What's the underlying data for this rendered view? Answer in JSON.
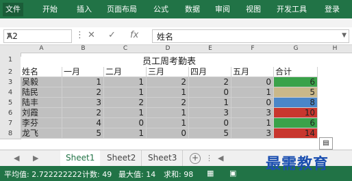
{
  "ribbon": {
    "tabs": [
      "文件",
      "开始",
      "插入",
      "页面布局",
      "公式",
      "数据",
      "审阅",
      "视图",
      "开发工具",
      "登录"
    ]
  },
  "formula_bar": {
    "name_box": "A2",
    "fx": "fx",
    "value": "姓名"
  },
  "columns": [
    "A",
    "B",
    "C",
    "D",
    "E",
    "F",
    "G",
    "H"
  ],
  "rows": [
    "1",
    "2",
    "3",
    "4",
    "5",
    "6",
    "7",
    "8"
  ],
  "table": {
    "title": "员工周考勤表",
    "headers": [
      "姓名",
      "一月",
      "二月",
      "三月",
      "四月",
      "五月",
      "合计"
    ],
    "data": [
      {
        "name": "吴毅",
        "v": [
          1,
          1,
          2,
          2,
          0
        ],
        "total": 6,
        "color": "#3aa24a"
      },
      {
        "name": "陆民",
        "v": [
          2,
          1,
          1,
          0,
          1
        ],
        "total": 5,
        "color": "#c9b88a"
      },
      {
        "name": "陆丰",
        "v": [
          3,
          2,
          2,
          1,
          0
        ],
        "total": 8,
        "color": "#4a86c8"
      },
      {
        "name": "刘霞",
        "v": [
          2,
          1,
          1,
          3,
          3
        ],
        "total": 10,
        "color": "#c8362e"
      },
      {
        "name": "李芬",
        "v": [
          4,
          0,
          1,
          0,
          1
        ],
        "total": 6,
        "color": "#3aa24a"
      },
      {
        "name": "龙飞",
        "v": [
          5,
          1,
          0,
          5,
          3
        ],
        "total": 14,
        "color": "#c8362e"
      }
    ]
  },
  "sheets": [
    "Sheet1",
    "Sheet2",
    "Sheet3"
  ],
  "status": {
    "avg_label": "平均值: 2.722222222",
    "count_label": "计数: 49",
    "max_label": "最大值: 14",
    "sum_label": "求和: 98"
  },
  "watermark": "最需教育"
}
